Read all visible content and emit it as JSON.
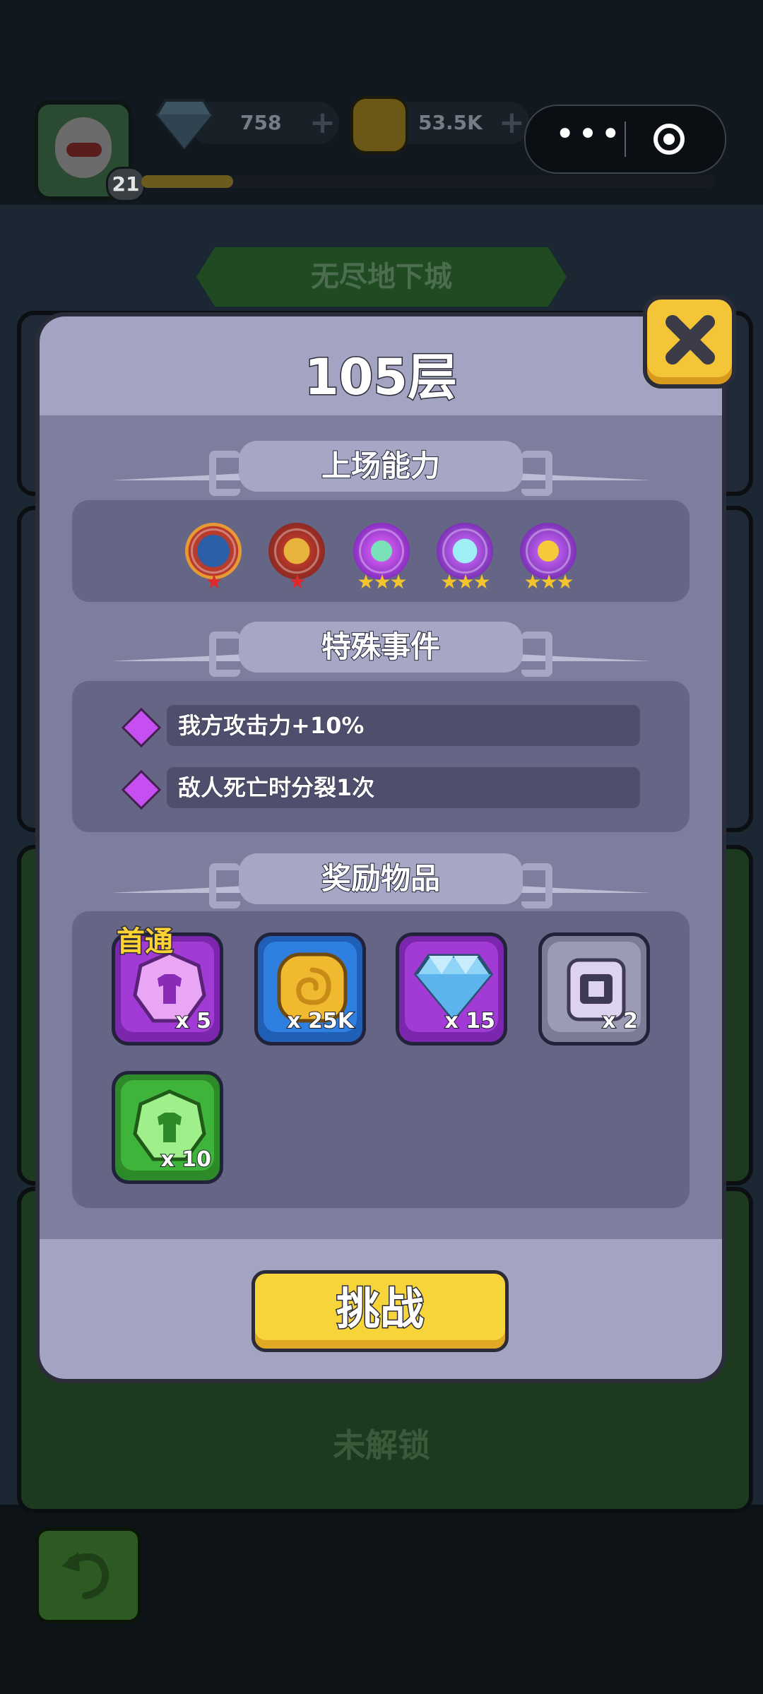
{
  "hud": {
    "level": "21",
    "xp_progress": 0.16,
    "gems": "758",
    "coins": "53.5K"
  },
  "background": {
    "banner": "无尽地下城",
    "locked_text": "未解锁"
  },
  "mini_program": {
    "more_icon": "more-dots-icon",
    "close_icon": "target-circle-icon"
  },
  "modal": {
    "title": "105层",
    "sections": {
      "abilities": "上场能力",
      "events": "特殊事件",
      "rewards": "奖励物品"
    },
    "abilities": [
      {
        "icon": "sword-ability-icon",
        "stars": "★",
        "star_color": "#e0282a"
      },
      {
        "icon": "hexagram-ability-icon",
        "stars": "★",
        "star_color": "#e0282a"
      },
      {
        "icon": "capsule-ability-icon",
        "stars": "★★★",
        "star_color": "#f3c42c"
      },
      {
        "icon": "crystal-shield-ability-icon",
        "stars": "★★★",
        "star_color": "#f3c42c"
      },
      {
        "icon": "lightning-ability-icon",
        "stars": "★★★",
        "star_color": "#f3c42c"
      }
    ],
    "events": [
      {
        "text": "我方攻击力+10%"
      },
      {
        "text": "敌人死亡时分裂1次"
      }
    ],
    "first_clear_label": "首通",
    "rewards": [
      {
        "icon": "purple-armor-gem-icon",
        "qty": "x 5",
        "color": "#a23ad6"
      },
      {
        "icon": "gold-coin-icon",
        "qty": "x 25K",
        "color": "#2f7fe0"
      },
      {
        "icon": "diamond-icon",
        "qty": "x 15",
        "color": "#a23ad6"
      },
      {
        "icon": "device-chip-icon",
        "qty": "x 2",
        "color": "#9c9bb4"
      },
      {
        "icon": "green-armor-gem-icon",
        "qty": "x 10",
        "color": "#3fb43a"
      }
    ],
    "challenge_label": "挑战"
  },
  "colors": {
    "modal_bg": "#a3a4c2",
    "body_bg": "#7d7d9e",
    "panel_bg": "#656585",
    "accent_yellow": "#f6d43a"
  }
}
